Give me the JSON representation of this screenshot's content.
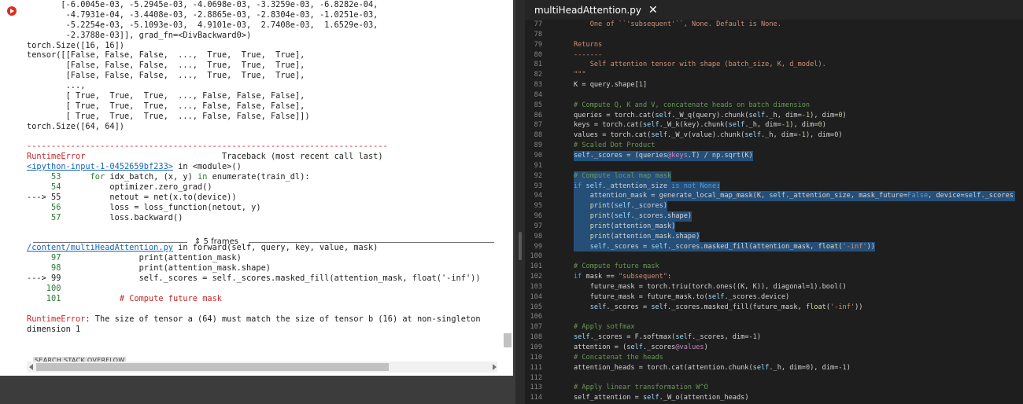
{
  "notebook": {
    "output_lines": [
      {
        "t": "       [-6.0045e-03, -5.2945e-03, -4.0698e-03, -3.3259e-03, -6.8282e-04,"
      },
      {
        "t": "        -4.7931e-04, -3.4408e-03, -2.8865e-03, -2.8304e-03, -1.0251e-03,"
      },
      {
        "t": "        -5.2254e-03, -5.1093e-03,  4.9101e-03,  2.7408e-03,  1.6529e-03,"
      },
      {
        "t": "        -2.3788e-03]], grad_fn=<DivBackward0>)"
      },
      {
        "t": "torch.Size([16, 16])"
      },
      {
        "t": "tensor([[False, False, False,  ...,  True,  True,  True],"
      },
      {
        "t": "        [False, False, False,  ...,  True,  True,  True],"
      },
      {
        "t": "        [False, False, False,  ...,  True,  True,  True],"
      },
      {
        "t": "        ...,"
      },
      {
        "t": "        [ True,  True,  True,  ..., False, False, False],"
      },
      {
        "t": "        [ True,  True,  True,  ..., False, False, False],"
      },
      {
        "t": "        [ True,  True,  True,  ..., False, False, False]])"
      },
      {
        "t": "torch.Size([64, 64])"
      }
    ],
    "dash_line": "--------------------------------------------------------------------------",
    "error_name": "RuntimeError",
    "traceback_label": "Traceback (most recent call last)",
    "input_link": "<ipython-input-1-0452659bf233>",
    "in_module": " in <module>()",
    "tb1": [
      {
        "n": "     53",
        "code": "for idx_batch, (x, y) in enumerate(train_dl):"
      },
      {
        "n": "     54",
        "code": "    optimizer.zero_grad()"
      },
      {
        "n": "---> 55",
        "code": "    netout = net(x.to(device))"
      },
      {
        "n": "     56",
        "code": "    loss = loss_function(netout, y)"
      },
      {
        "n": "     57",
        "code": "    loss.backward()"
      }
    ],
    "frames_label": "⇕ 5 frames",
    "file_link": "/content/multiHeadAttention.py",
    "in_forward": " in forward(self, query, key, value, mask)",
    "tb2": [
      {
        "n": "     97",
        "code": "            print(attention_mask)"
      },
      {
        "n": "     98",
        "code": "            print(attention_mask.shape)"
      },
      {
        "n": "---> 99",
        "code": "            self._scores = self._scores.masked_fill(attention_mask, float('-inf'))"
      },
      {
        "n": "    100",
        "code": ""
      },
      {
        "n": "    101",
        "code": "        # Compute future mask"
      }
    ],
    "error_message": ": The size of tensor a (64) must match the size of tensor b (16) at non-singleton",
    "error_message2": "dimension 1",
    "search_button": "SEARCH STACK OVERFLOW"
  },
  "editor": {
    "tab_title": "multiHeadAttention.py",
    "close_icon": "close-icon",
    "lines": [
      {
        "n": "77",
        "h": "<span class=\"ds\">    One of ``'subsequent'``, None. Default is None.</span>"
      },
      {
        "n": "78",
        "h": ""
      },
      {
        "n": "79",
        "h": "<span class=\"ds\">Returns</span>"
      },
      {
        "n": "80",
        "h": "<span class=\"ds\">-------</span>"
      },
      {
        "n": "81",
        "h": "<span class=\"ds\">    Self attention tensor with shape (batch_size, K, d_model).</span>"
      },
      {
        "n": "82",
        "h": "<span class=\"ds\">\"\"\"</span>"
      },
      {
        "n": "83",
        "h": "K = query.shape[<span class=\"nm\">1</span>]"
      },
      {
        "n": "84",
        "h": ""
      },
      {
        "n": "85",
        "h": "<span class=\"cm\"># Compute Q, K and V, concatenate heads on batch dimension</span>"
      },
      {
        "n": "86",
        "h": "queries = torch.cat(<span class=\"sf\">self</span>._W_q(query).chunk(<span class=\"sf\">self</span>._h, dim=<span class=\"nm\">-1</span>), dim=<span class=\"nm\">0</span>)"
      },
      {
        "n": "87",
        "h": "keys = torch.cat(<span class=\"sf\">self</span>._W_k(key).chunk(<span class=\"sf\">self</span>._h, dim=<span class=\"nm\">-1</span>), dim=<span class=\"nm\">0</span>)"
      },
      {
        "n": "88",
        "h": "values = torch.cat(<span class=\"sf\">self</span>._W_v(value).chunk(<span class=\"sf\">self</span>._h, dim=<span class=\"nm\">-1</span>), dim=<span class=\"nm\">0</span>)"
      },
      {
        "n": "89",
        "h": "<span class=\"cm\"># Scaled Dot Product</span>"
      },
      {
        "n": "90",
        "h": "<span class=\"sf\">self</span>._scores = (queries<span class=\"pur\">@keys</span>.T) / np.sqrt(K)",
        "sel": true
      },
      {
        "n": "91",
        "h": "",
        "sel": true
      },
      {
        "n": "92",
        "h": "<span class=\"cm\"># Compute local map mask</span>",
        "sel": true
      },
      {
        "n": "93",
        "h": "<span class=\"kw\">if</span> <span class=\"sf\">self</span>._attention_size <span class=\"kw\">is not</span> <span class=\"kw\">None</span>:",
        "sel": true
      },
      {
        "n": "94",
        "h": "    attention_mask = generate_local_map_mask(K, <span class=\"sf\">self</span>._attention_size, mask_future=<span class=\"kw\">False</span>, device=<span class=\"sf\">self</span>._scores.device)",
        "sel": true
      },
      {
        "n": "95",
        "h": "    <span class=\"fn\">print</span>(<span class=\"sf\">self</span>._scores)",
        "sel": true
      },
      {
        "n": "96",
        "h": "    <span class=\"fn\">print</span>(<span class=\"sf\">self</span>._scores.shape)",
        "sel": true
      },
      {
        "n": "97",
        "h": "    <span class=\"fn\">print</span>(attention_mask)",
        "sel": true
      },
      {
        "n": "98",
        "h": "    <span class=\"fn\">print</span>(attention_mask.shape)",
        "sel": true
      },
      {
        "n": "99",
        "h": "    <span class=\"sf\">self</span>._scores = <span class=\"sf\">self</span>._scores.masked_fill(attention_mask, <span class=\"fn\">float</span>(<span class=\"st\">'-inf'</span>))",
        "sel": true
      },
      {
        "n": "100",
        "h": ""
      },
      {
        "n": "101",
        "h": "<span class=\"cm\"># Compute future mask</span>"
      },
      {
        "n": "102",
        "h": "<span class=\"kw\">if</span> mask == <span class=\"st\">\"subsequent\"</span>:"
      },
      {
        "n": "103",
        "h": "    future_mask = torch.triu(torch.ones((K, K)), diagonal=<span class=\"nm\">1</span>).bool()"
      },
      {
        "n": "104",
        "h": "    future_mask = future_mask.to(<span class=\"sf\">self</span>._scores.device)"
      },
      {
        "n": "105",
        "h": "    <span class=\"sf\">self</span>._scores = <span class=\"sf\">self</span>._scores.masked_fill(future_mask, <span class=\"fn\">float</span>(<span class=\"st\">'-inf'</span>))"
      },
      {
        "n": "106",
        "h": ""
      },
      {
        "n": "107",
        "h": "<span class=\"cm\"># Apply sotfmax</span>"
      },
      {
        "n": "108",
        "h": "<span class=\"sf\">self</span>._scores = F.softmax(<span class=\"sf\">self</span>._scores, dim=<span class=\"nm\">-1</span>)"
      },
      {
        "n": "109",
        "h": "attention = (<span class=\"sf\">self</span>._scores<span class=\"pur\">@values</span>)"
      },
      {
        "n": "110",
        "h": "<span class=\"cm\"># Concatenat the heads</span>"
      },
      {
        "n": "111",
        "h": "attention_heads = torch.cat(attention.chunk(<span class=\"sf\">self</span>._h, dim=<span class=\"nm\">0</span>), dim=<span class=\"nm\">-1</span>)"
      },
      {
        "n": "112",
        "h": ""
      },
      {
        "n": "113",
        "h": "<span class=\"cm\"># Apply linear transformation W^O</span>"
      },
      {
        "n": "114",
        "h": "self_attention = <span class=\"sf\">self</span>._W_o(attention_heads)"
      }
    ]
  },
  "colors": {
    "editor_bg": "#1e1e1e",
    "selection": "#264f78",
    "error_red": "#c62828",
    "link_blue": "#1565c0"
  }
}
